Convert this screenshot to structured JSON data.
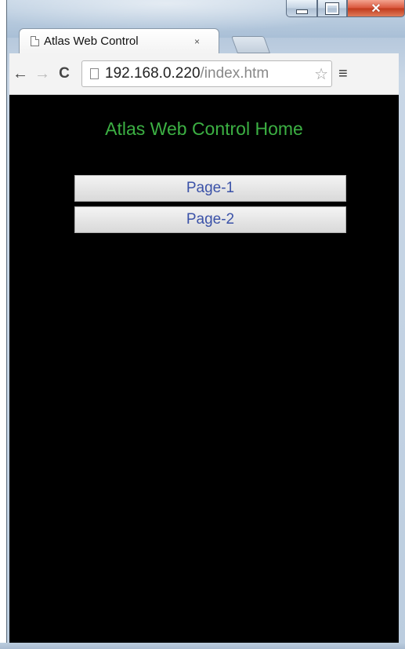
{
  "window": {
    "controls": {
      "minimize": "minimize",
      "maximize": "maximize",
      "close_glyph": "✕"
    }
  },
  "tab": {
    "title": "Atlas Web Control",
    "close_glyph": "×"
  },
  "toolbar": {
    "back_glyph": "←",
    "forward_glyph": "→",
    "reload_glyph": "C",
    "url_host": "192.168.0.220",
    "url_path": "/index.htm",
    "star_glyph": "☆",
    "menu_glyph": "≡"
  },
  "page": {
    "title": "Atlas Web Control Home",
    "links": [
      {
        "label": "Page-1"
      },
      {
        "label": "Page-2"
      }
    ]
  },
  "colors": {
    "page_background": "#000000",
    "title_color": "#3cb043",
    "link_color": "#3b52a8"
  }
}
